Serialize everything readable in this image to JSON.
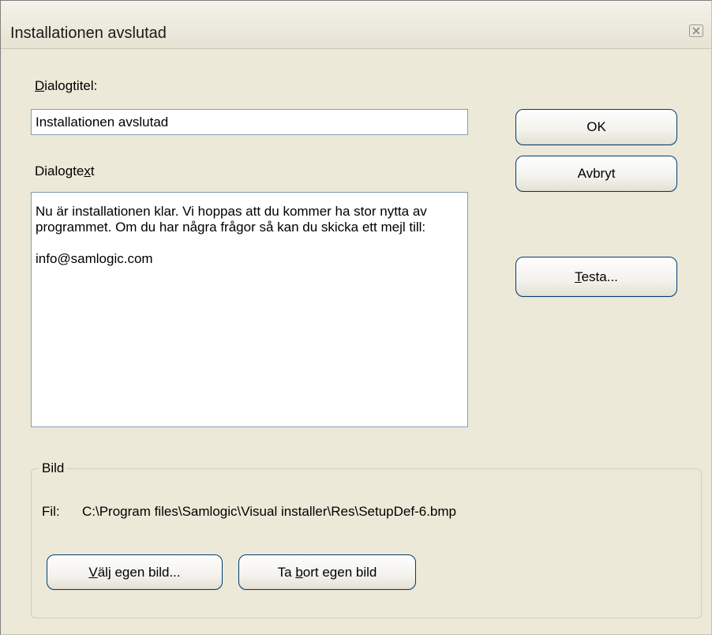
{
  "window": {
    "title": "Installationen avslutad",
    "close_icon": "close-icon"
  },
  "form": {
    "dialog_title_label_accel": "D",
    "dialog_title_label_rest": "ialogtitel:",
    "dialog_title_value": "Installationen avslutad",
    "dialog_text_label_pre": "Dialogte",
    "dialog_text_label_accel": "x",
    "dialog_text_label_post": "t",
    "dialog_text_value": "Nu är installationen klar. Vi hoppas att du kommer ha stor nytta av programmet. Om du har några frågor så kan du skicka ett mejl till:\n\ninfo@samlogic.com"
  },
  "buttons": {
    "ok": "OK",
    "cancel": "Avbryt",
    "test_accel": "T",
    "test_rest": "esta..."
  },
  "image_group": {
    "legend": "Bild",
    "file_label": "Fil:",
    "file_path": "C:\\Program files\\Samlogic\\Visual installer\\Res\\SetupDef-6.bmp",
    "choose_accel": "V",
    "choose_rest": "älj egen bild...",
    "remove_pre": "Ta ",
    "remove_accel": "b",
    "remove_post": "ort egen bild"
  }
}
